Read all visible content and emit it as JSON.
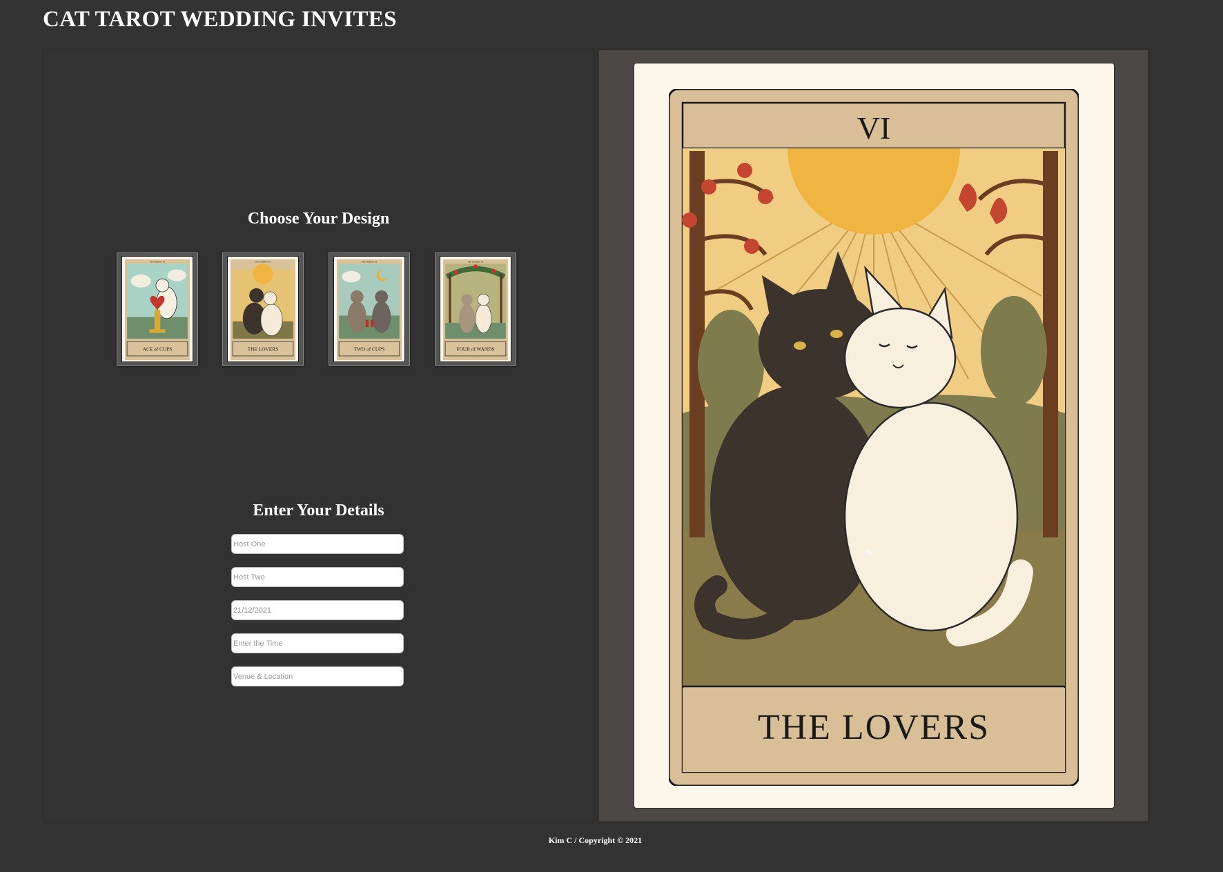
{
  "header": {
    "title": "CAT TAROT WEDDING INVITES"
  },
  "design_section": {
    "title": "Choose Your Design",
    "designs": [
      {
        "name": "ACE of CUPS",
        "top_text": "THE WEDDING OF"
      },
      {
        "name": "THE LOVERS",
        "numeral": "VI",
        "top_text": "THE WEDDING OF"
      },
      {
        "name": "TWO of CUPS",
        "top_text": "THE WEDDING OF"
      },
      {
        "name": "FOUR of WANDS",
        "top_text": "THE WEDDING OF"
      }
    ],
    "selected": "THE LOVERS"
  },
  "details_section": {
    "title": "Enter Your Details",
    "fields": {
      "host_one_placeholder": "Host One",
      "host_two_placeholder": "Host Two",
      "date_value": "21/12/2021",
      "time_placeholder": "Enter the Time",
      "venue_placeholder": "Venue & Location"
    }
  },
  "preview": {
    "numeral": "VI",
    "card_name": "THE LOVERS",
    "ampersand": "&"
  },
  "footer": {
    "text": "Kim C / Copyright © 2021"
  },
  "colors": {
    "page_bg": "#333333",
    "preview_panel_bg": "#4b4846",
    "card_paper": "#fdf6ea",
    "card_frame": "#d8bf98",
    "sun": "#f0b540"
  }
}
